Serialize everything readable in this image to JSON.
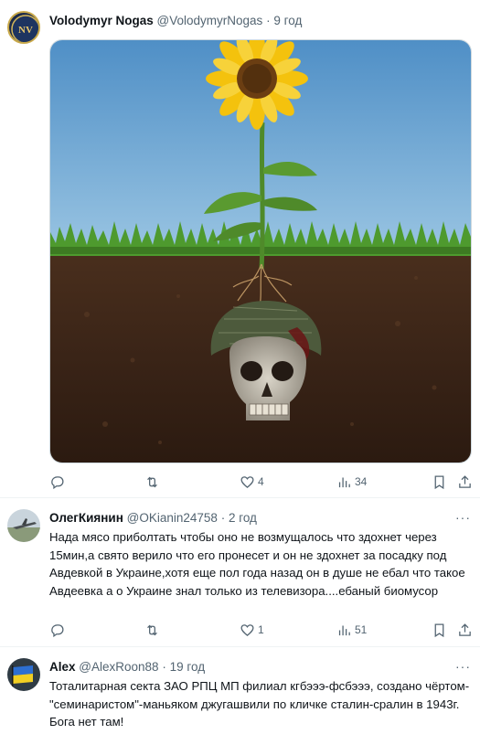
{
  "posts": [
    {
      "author": "Volodymyr Nogas",
      "handle": "@VolodymyrNogas",
      "separator": "·",
      "time": "9 год",
      "avatar_initials": "NV",
      "stats": {
        "replies": "",
        "reposts": "",
        "likes": "4",
        "views": "34"
      }
    },
    {
      "author": "ОлегКиянин",
      "handle": "@OKianin24758",
      "separator": "·",
      "time": "2 год",
      "text": "Нада мясо приболтать чтобы оно не возмущалось что здохнет через 15мин,а свято верило что его пронесет и он не здохнет за посадку под Авдевкой в Украине,хотя еще пол года назад он в душе не ебал что такое Авдеевка а о Украине знал только из телевизора....ебаный биомусор",
      "stats": {
        "replies": "",
        "reposts": "",
        "likes": "1",
        "views": "51"
      }
    },
    {
      "author": "Alex",
      "handle": "@AlexRoon88",
      "separator": "·",
      "time": "19 год",
      "text": "Тоталитарная секта ЗАО РПЦ МП филиал кгбэээ-фсбэээ, создано чёртом-\"семинаристом\"-маньяком джугашвили по кличке сталин-сралин в 1943г. Бога нет там!"
    }
  ],
  "more_label": "···",
  "colors": {
    "text_primary": "#0f1419",
    "text_secondary": "#536471",
    "divider": "#eff3f4"
  }
}
